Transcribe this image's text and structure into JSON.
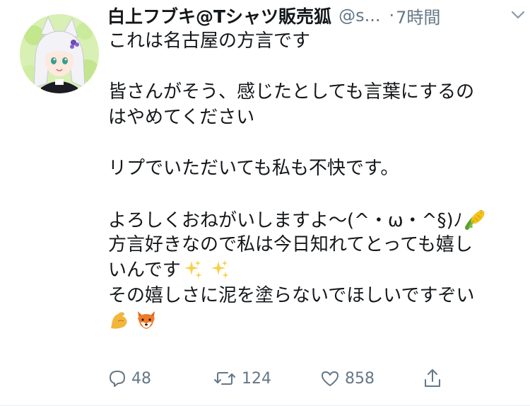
{
  "tweet": {
    "display_name": "白上フブキ@Tシャツ販売狐",
    "handle": "@s...",
    "separator": "·",
    "time": "7時間",
    "lines": {
      "l1": "これは名古屋の方言です",
      "l2": "皆さんがそう、感じたとしても言葉にするの",
      "l3": "はやめてください",
      "l4": "リプでいただいても私も不快です。",
      "l5": "よろしくおねがいしますよ〜(^・ω・^§)ﾉ",
      "l6": "方言好きなので私は今日知れてとっても嬉し",
      "l7": "いんです",
      "l8": "その嬉しさに泥を塗らないでほしいですぞい"
    },
    "emoji_names": [
      "corn-emoji",
      "sparkles-emoji",
      "sparkles-emoji",
      "flexed-biceps-emoji",
      "fox-face-emoji"
    ]
  },
  "actions": {
    "reply_count": "48",
    "retweet_count": "124",
    "like_count": "858"
  },
  "colors": {
    "text": "#14171a",
    "muted": "#657786",
    "border": "#e6ecf0"
  }
}
